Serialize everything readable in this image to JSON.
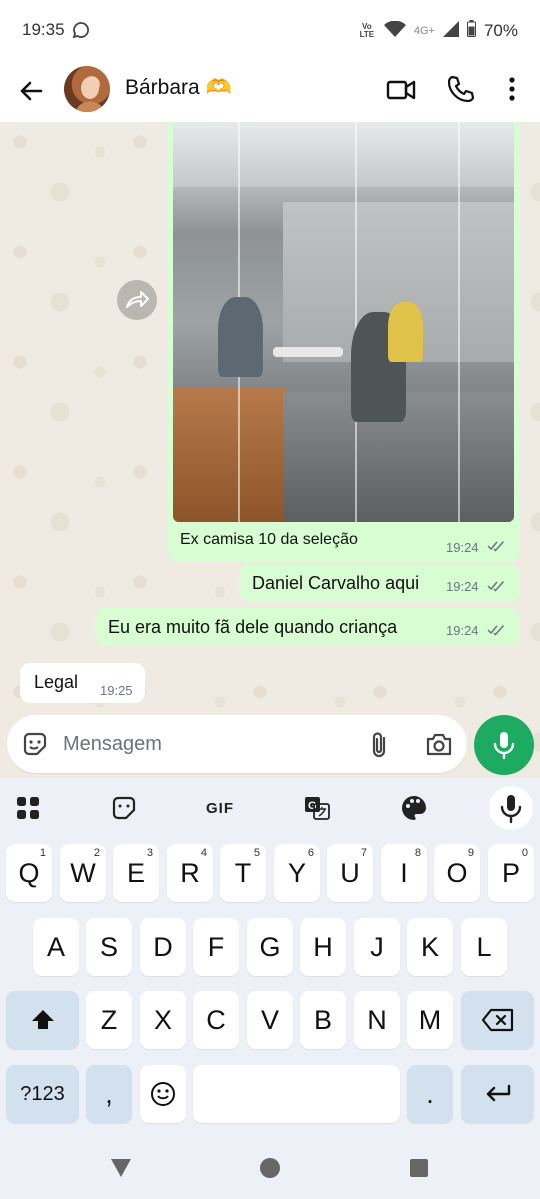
{
  "status_bar": {
    "time": "19:35",
    "network_label": "Vo LTE",
    "network_type": "4G+",
    "battery": "70%"
  },
  "header": {
    "contact_name": "Bárbara 🫶"
  },
  "chat": {
    "messages": [
      {
        "direction": "out",
        "text": "Ex camisa 10 da seleção",
        "time": "19:24",
        "status": "read"
      },
      {
        "direction": "out",
        "text": "Daniel Carvalho aqui",
        "time": "19:24",
        "status": "read"
      },
      {
        "direction": "out",
        "text": "Eu era muito fã dele quando criança",
        "time": "19:24",
        "status": "read"
      },
      {
        "direction": "in",
        "text": "Legal",
        "time": "19:25"
      }
    ]
  },
  "composer": {
    "placeholder": "Mensagem"
  },
  "keyboard": {
    "toolbar": {
      "gif_label": "GIF"
    },
    "rows": [
      [
        {
          "label": "Q",
          "hint": "1"
        },
        {
          "label": "W",
          "hint": "2"
        },
        {
          "label": "E",
          "hint": "3"
        },
        {
          "label": "R",
          "hint": "4"
        },
        {
          "label": "T",
          "hint": "5"
        },
        {
          "label": "Y",
          "hint": "6"
        },
        {
          "label": "U",
          "hint": "7"
        },
        {
          "label": "I",
          "hint": "8"
        },
        {
          "label": "O",
          "hint": "9"
        },
        {
          "label": "P",
          "hint": "0"
        }
      ],
      [
        {
          "label": "A"
        },
        {
          "label": "S"
        },
        {
          "label": "D"
        },
        {
          "label": "F"
        },
        {
          "label": "G"
        },
        {
          "label": "H"
        },
        {
          "label": "J"
        },
        {
          "label": "K"
        },
        {
          "label": "L"
        }
      ],
      [
        {
          "label": "Z"
        },
        {
          "label": "X"
        },
        {
          "label": "C"
        },
        {
          "label": "V"
        },
        {
          "label": "B"
        },
        {
          "label": "N"
        },
        {
          "label": "M"
        }
      ]
    ],
    "symbols_label": "?123",
    "comma_label": ",",
    "period_label": "."
  },
  "colors": {
    "outgoing_bubble": "#d9fdd3",
    "incoming_bubble": "#ffffff",
    "accent_green": "#1daa61",
    "chat_background": "#efeae2",
    "keyboard_background": "#eef0f8"
  },
  "icons": {
    "back": "arrow-left-icon",
    "video": "video-camera-icon",
    "call": "phone-icon",
    "menu": "three-dots-vertical-icon",
    "forward": "forward-arrow-icon",
    "emoji": "sticker-face-icon",
    "attach": "paperclip-icon",
    "camera": "camera-icon",
    "mic": "microphone-icon"
  }
}
